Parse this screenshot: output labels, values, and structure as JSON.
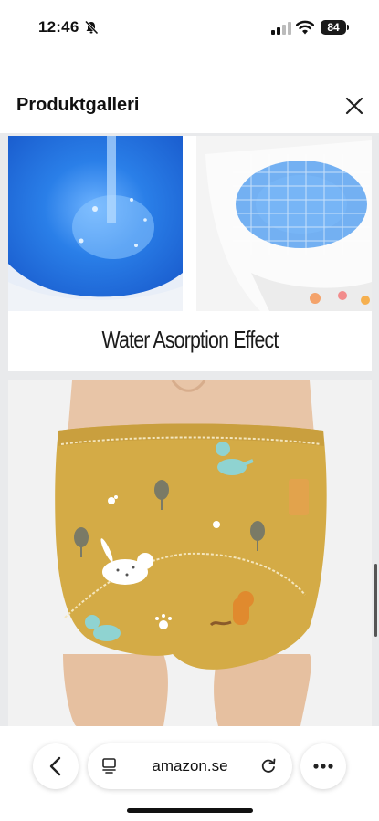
{
  "status_bar": {
    "time": "12:46",
    "battery": "84",
    "icons": [
      "bell-slash-icon",
      "signal-icon",
      "wifi-icon",
      "battery-icon"
    ]
  },
  "header": {
    "title": "Produktgalleri",
    "close_icon": "close-icon"
  },
  "gallery": {
    "images": [
      {
        "caption": "Water Asorption Effect"
      },
      {
        "caption": ""
      }
    ]
  },
  "toolbar": {
    "url": "amazon.se",
    "icons": [
      "chevron-left-icon",
      "tabs-icon",
      "reload-icon",
      "more-icon"
    ]
  },
  "colors": {
    "pant_yellow": "#d4ab46",
    "water_blue": "#2a7fe8",
    "background": "#ffffff"
  }
}
